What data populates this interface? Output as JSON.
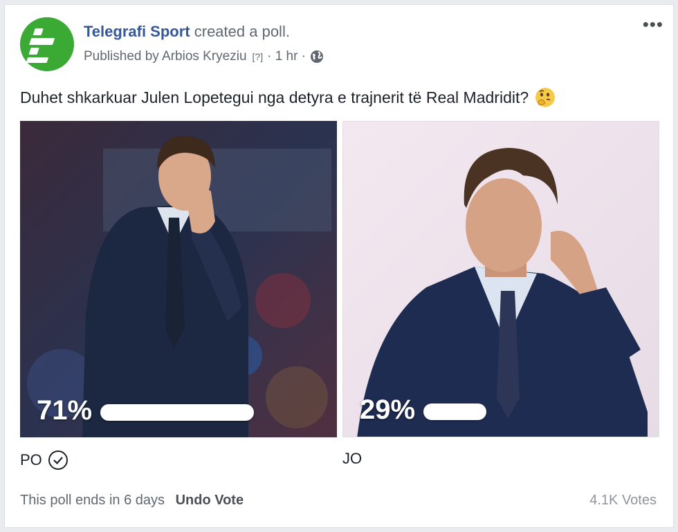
{
  "post": {
    "page_name": "Telegrafi Sport",
    "action_text": "created a poll.",
    "published_by": "Published by Arbios Kryeziu",
    "help_marker": "[?]",
    "time": "· 1 hr ·",
    "more_icon": "•••",
    "question": "Duhet shkarkuar Julen Lopetegui nga detyra e trajnerit të Real Madridit?",
    "emoji_icon": "thinking-face-icon",
    "brand_color": "#3aaa35"
  },
  "poll": {
    "options": [
      {
        "label": "PO",
        "percent_label": "71%",
        "percent": 71,
        "voted": true
      },
      {
        "label": "JO",
        "percent_label": "29%",
        "percent": 29,
        "voted": false
      }
    ],
    "ends_text": "This poll ends in 6 days",
    "undo_label": "Undo Vote",
    "votes": "4.1K Votes"
  }
}
